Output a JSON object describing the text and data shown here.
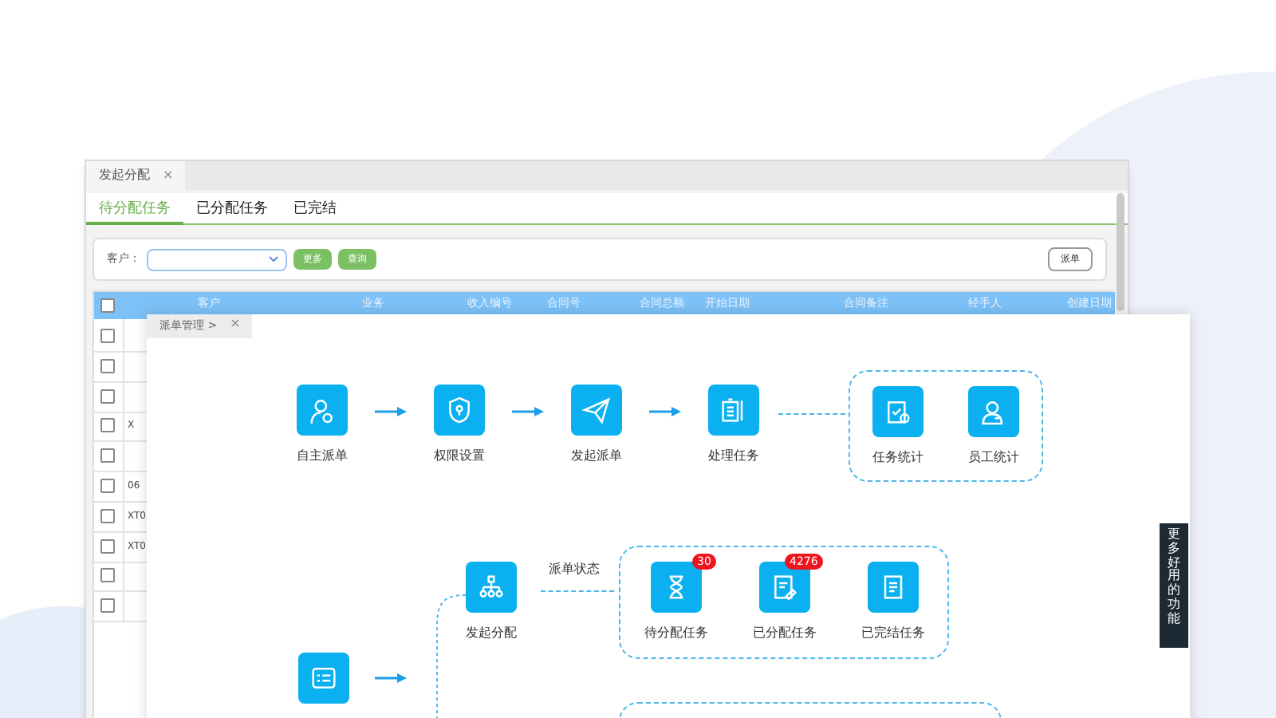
{
  "task_window": {
    "tab": {
      "label": "发起分配",
      "close": "×"
    },
    "subtabs": [
      {
        "label": "待分配任务",
        "selected": true
      },
      {
        "label": "已分配任务",
        "selected": false
      },
      {
        "label": "已完结",
        "selected": false
      }
    ],
    "filter": {
      "label": "客户：",
      "buttons": [
        "更多",
        "查询"
      ],
      "action": "派单"
    },
    "table": {
      "header_checked": false,
      "columns": [
        "客户",
        "业务",
        "收入编号",
        "合同号",
        "合同总额",
        "开始日期",
        "合同备注",
        "经手人",
        "创建日期"
      ],
      "rows": [
        {
          "checked": false
        },
        {
          "checked": false
        },
        {
          "checked": false
        },
        {
          "checked": false,
          "cell": "X"
        },
        {
          "checked": false
        },
        {
          "checked": false,
          "cell": "06"
        },
        {
          "checked": false,
          "cell": "XT0"
        },
        {
          "checked": false,
          "cell": "XT0"
        },
        {
          "checked": false
        },
        {
          "checked": false
        }
      ]
    }
  },
  "flow_window": {
    "tab": {
      "label": "派单管理 >",
      "close": "×"
    },
    "steps": [
      {
        "label": "自主派单"
      },
      {
        "label": "权限设置"
      },
      {
        "label": "发起派单"
      },
      {
        "label": "处理任务"
      }
    ],
    "stats": [
      {
        "label": "任务统计"
      },
      {
        "label": "员工统计"
      }
    ],
    "assign": {
      "node": "发起分配",
      "link_label": "派单状态",
      "states": [
        {
          "label": "待分配任务",
          "badge": "30"
        },
        {
          "label": "已分配任务",
          "badge": "4276"
        },
        {
          "label": "已完结任务"
        }
      ]
    }
  },
  "side_tab": "更多好用的功能"
}
